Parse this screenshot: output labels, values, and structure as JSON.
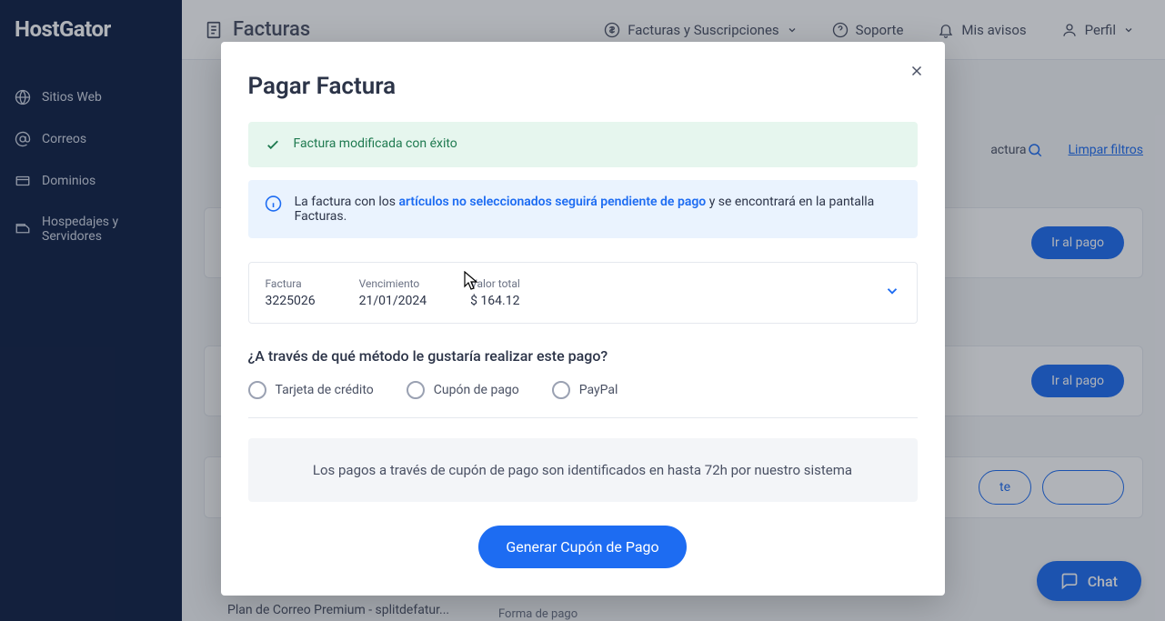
{
  "brand": "HostGator",
  "sidebar": {
    "items": [
      {
        "label": "Sitios Web"
      },
      {
        "label": "Correos"
      },
      {
        "label": "Dominios"
      },
      {
        "label": "Hospedajes y Servidores"
      }
    ]
  },
  "topbar": {
    "title": "Facturas",
    "items": [
      {
        "label": "Facturas y Suscripciones"
      },
      {
        "label": "Soporte"
      },
      {
        "label": "Mis avisos"
      },
      {
        "label": "Perfil"
      }
    ]
  },
  "search": {
    "placeholder_fragment": "actura",
    "clear": "Limpar filtros"
  },
  "pay_button": "Ir al pago",
  "row_bottom_button_partial": "te",
  "plan_text": "Plan de Correo Premium - splitdefatur...",
  "forma_label": "Forma de pago",
  "chat_label": "Chat",
  "modal": {
    "title": "Pagar Factura",
    "success": "Factura modificada con éxito",
    "info_pre": "La factura con los ",
    "info_bold": "artículos no seleccionados seguirá pendiente de pago",
    "info_post": " y se encontrará en la pantalla Facturas.",
    "summary": {
      "invoice_label": "Factura",
      "invoice_value": "3225026",
      "due_label": "Vencimiento",
      "due_value": "21/01/2024",
      "total_label": "Valor total",
      "total_value": "$ 164.12"
    },
    "method_question": "¿A través de qué método le gustaría realizar este pago?",
    "methods": [
      {
        "label": "Tarjeta de crédito"
      },
      {
        "label": "Cupón de pago"
      },
      {
        "label": "PayPal"
      }
    ],
    "coupon_info": "Los pagos a través de cupón de pago son identificados en hasta 72h por nuestro sistema",
    "cta": "Generar Cupón de Pago"
  }
}
